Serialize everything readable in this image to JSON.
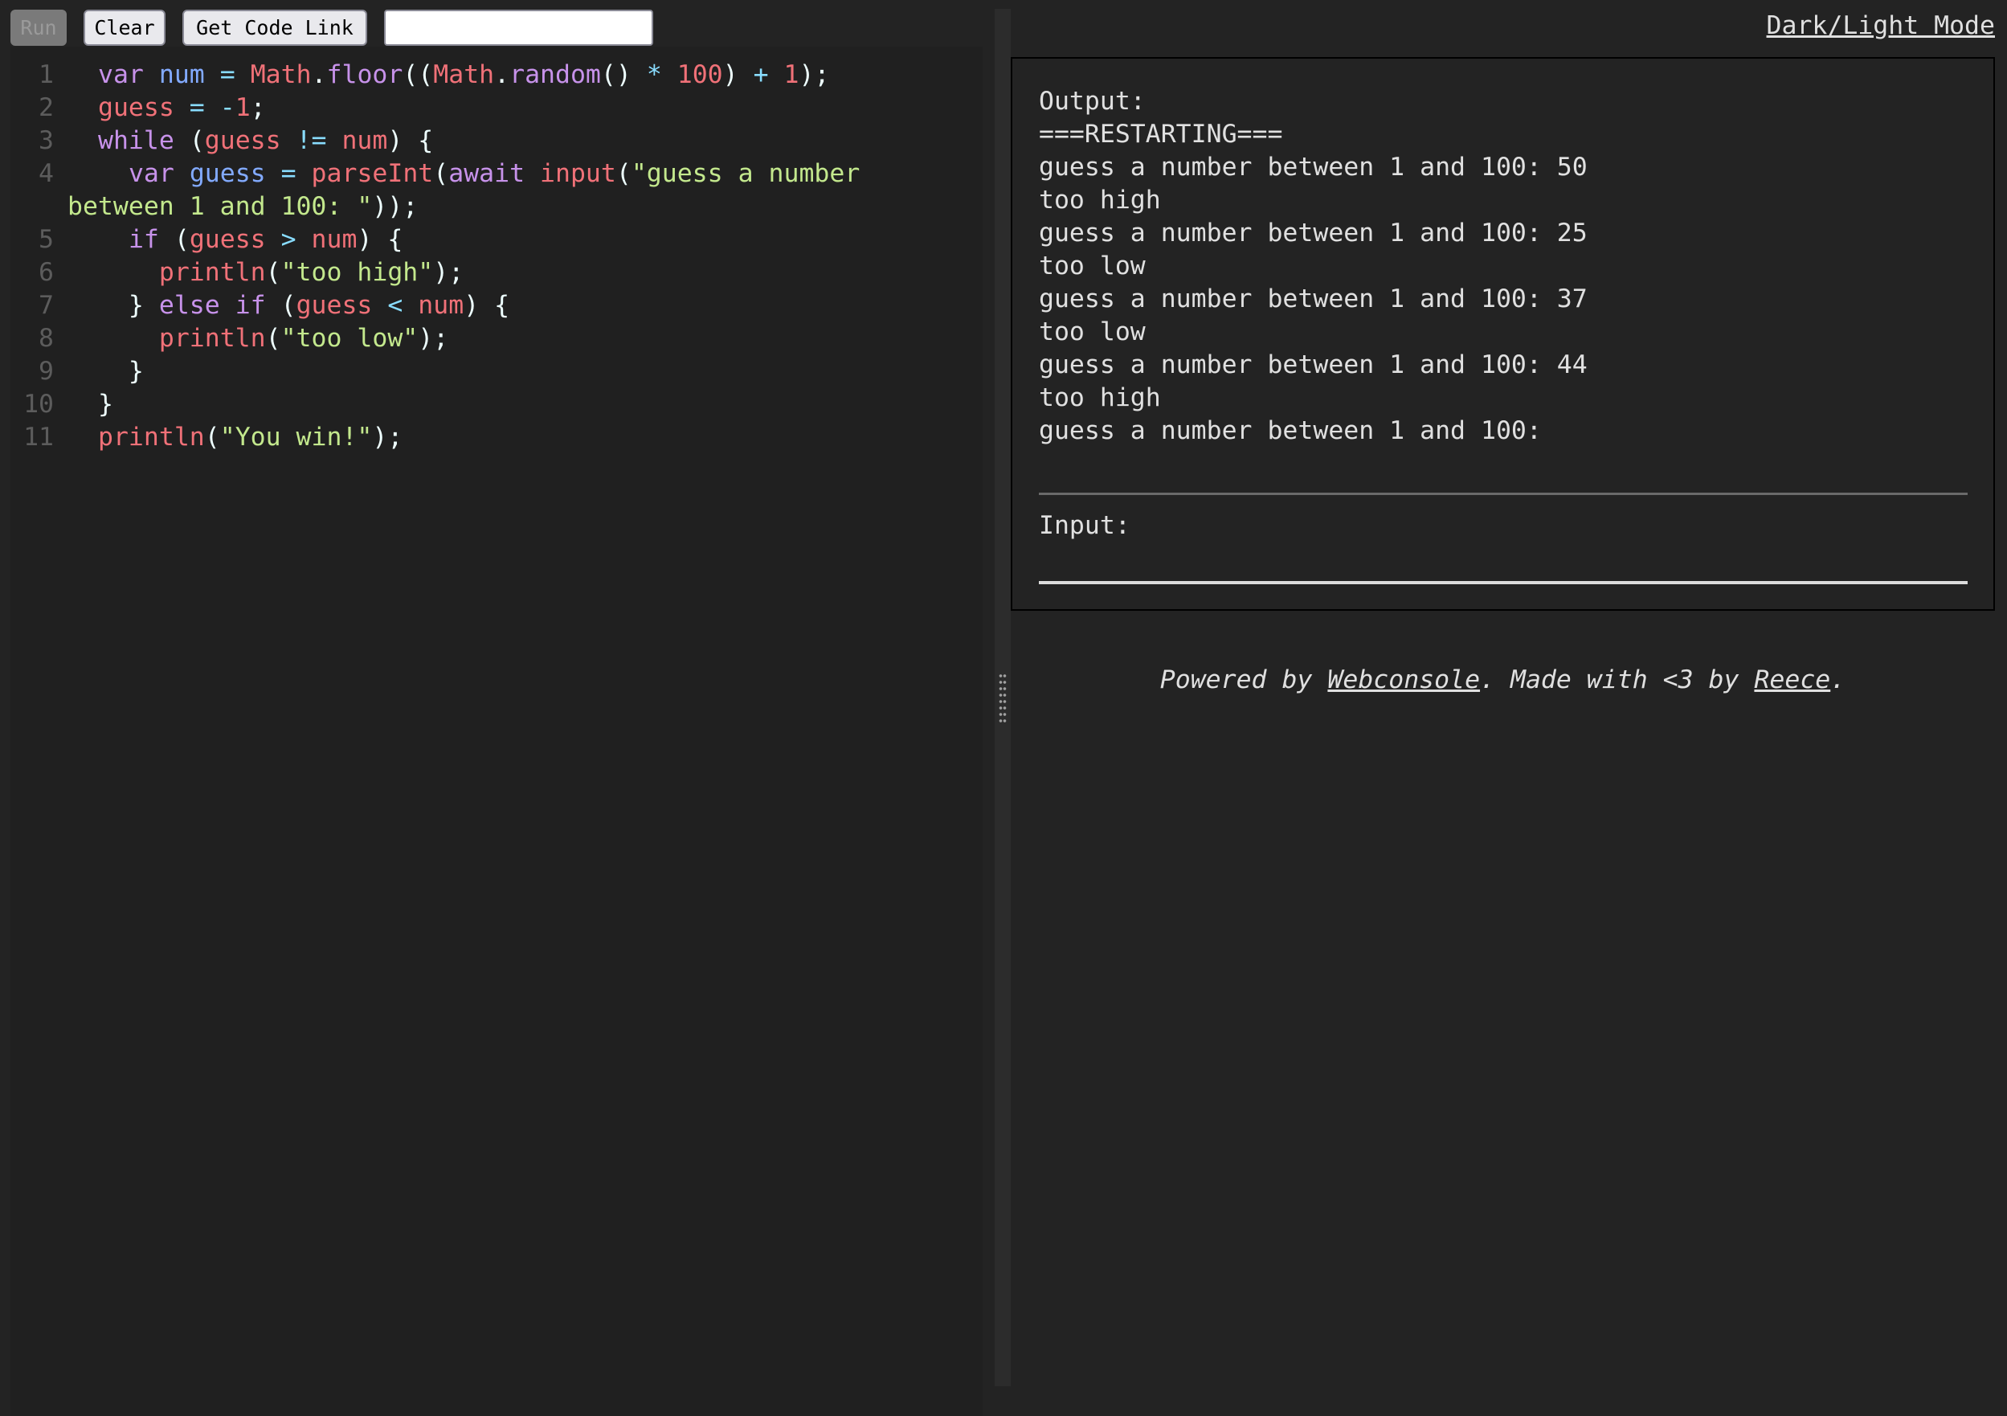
{
  "toolbar": {
    "run_label": "Run",
    "clear_label": "Clear",
    "get_link_label": "Get Code Link",
    "link_value": ""
  },
  "header": {
    "mode_toggle_label": "Dark/Light Mode"
  },
  "editor": {
    "line_numbers": [
      "1",
      "2",
      "3",
      "4",
      "5",
      "6",
      "7",
      "8",
      "9",
      "10",
      "11"
    ],
    "lines": [
      [
        [
          "k",
          "var"
        ],
        [
          "p",
          " "
        ],
        [
          "v",
          "num"
        ],
        [
          "p",
          " "
        ],
        [
          "o",
          "="
        ],
        [
          "p",
          " "
        ],
        [
          "r",
          "Math"
        ],
        [
          "p",
          "."
        ],
        [
          "f",
          "floor"
        ],
        [
          "p",
          "(("
        ],
        [
          "r",
          "Math"
        ],
        [
          "p",
          "."
        ],
        [
          "f",
          "random"
        ],
        [
          "p",
          "() "
        ],
        [
          "o",
          "*"
        ],
        [
          "p",
          " "
        ],
        [
          "r",
          "100"
        ],
        [
          "p",
          ") "
        ],
        [
          "o",
          "+"
        ],
        [
          "p",
          " "
        ],
        [
          "r",
          "1"
        ],
        [
          "p",
          ");"
        ]
      ],
      [
        [
          "r",
          "guess"
        ],
        [
          "p",
          " "
        ],
        [
          "o",
          "="
        ],
        [
          "p",
          " "
        ],
        [
          "o",
          "-"
        ],
        [
          "r",
          "1"
        ],
        [
          "p",
          ";"
        ]
      ],
      [
        [
          "k",
          "while"
        ],
        [
          "p",
          " ("
        ],
        [
          "r",
          "guess"
        ],
        [
          "p",
          " "
        ],
        [
          "o",
          "!="
        ],
        [
          "p",
          " "
        ],
        [
          "r",
          "num"
        ],
        [
          "p",
          ") {"
        ]
      ],
      [
        [
          "p",
          "  "
        ],
        [
          "k",
          "var"
        ],
        [
          "p",
          " "
        ],
        [
          "v",
          "guess"
        ],
        [
          "p",
          " "
        ],
        [
          "o",
          "="
        ],
        [
          "p",
          " "
        ],
        [
          "r",
          "parseInt"
        ],
        [
          "p",
          "("
        ],
        [
          "k",
          "await"
        ],
        [
          "p",
          " "
        ],
        [
          "r",
          "input"
        ],
        [
          "p",
          "("
        ],
        [
          "s",
          "\"guess a number"
        ]
      ],
      [
        [
          "p",
          "  "
        ],
        [
          "k",
          "if"
        ],
        [
          "p",
          " ("
        ],
        [
          "r",
          "guess"
        ],
        [
          "p",
          " "
        ],
        [
          "o",
          ">"
        ],
        [
          "p",
          " "
        ],
        [
          "r",
          "num"
        ],
        [
          "p",
          ") {"
        ]
      ],
      [
        [
          "p",
          "    "
        ],
        [
          "r",
          "println"
        ],
        [
          "p",
          "("
        ],
        [
          "s",
          "\"too high\""
        ],
        [
          "p",
          ");"
        ]
      ],
      [
        [
          "p",
          "  } "
        ],
        [
          "k",
          "else"
        ],
        [
          "p",
          " "
        ],
        [
          "k",
          "if"
        ],
        [
          "p",
          " ("
        ],
        [
          "r",
          "guess"
        ],
        [
          "p",
          " "
        ],
        [
          "o",
          "<"
        ],
        [
          "p",
          " "
        ],
        [
          "r",
          "num"
        ],
        [
          "p",
          ") {"
        ]
      ],
      [
        [
          "p",
          "    "
        ],
        [
          "r",
          "println"
        ],
        [
          "p",
          "("
        ],
        [
          "s",
          "\"too low\""
        ],
        [
          "p",
          ");"
        ]
      ],
      [
        [
          "p",
          "  }"
        ]
      ],
      [
        [
          "p",
          "}"
        ]
      ],
      [
        [
          "r",
          "println"
        ],
        [
          "p",
          "("
        ],
        [
          "s",
          "\"You win!\""
        ],
        [
          "p",
          ");"
        ]
      ]
    ],
    "wrapped_line_4": [
      [
        "s",
        "between 1 and 100: \""
      ],
      [
        "p",
        "));"
      ]
    ]
  },
  "console": {
    "output_lines": [
      "Output:",
      "===RESTARTING===",
      "guess a number between 1 and 100: 50",
      "too high",
      "guess a number between 1 and 100: 25",
      "too low",
      "guess a number between 1 and 100: 37",
      "too low",
      "guess a number between 1 and 100: 44",
      "too high",
      "guess a number between 1 and 100:"
    ],
    "input_label": "Input:",
    "input_value": ""
  },
  "footer": {
    "prefix": "Powered by ",
    "link1": "Webconsole",
    "middle": ". Made with <3 by ",
    "link2": "Reece",
    "suffix": "."
  }
}
